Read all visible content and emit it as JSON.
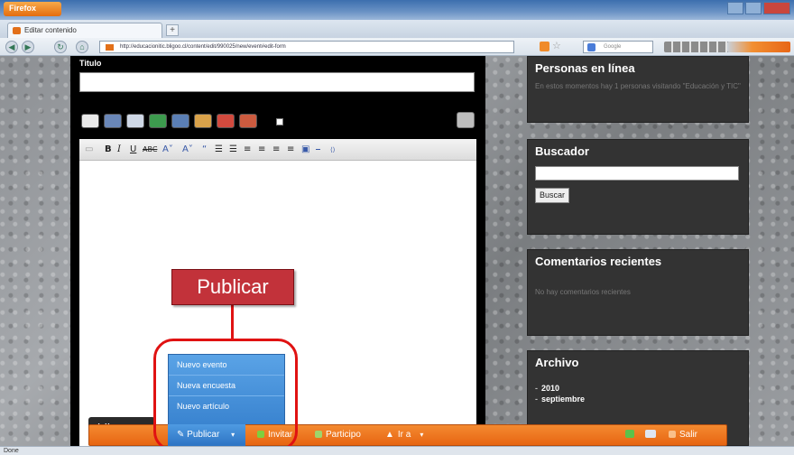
{
  "browser": {
    "app_button": "Firefox",
    "tab_title": "Editar contenido",
    "url": "http://educacionitic.bligoo.cl/content/edit/990025/new/event#edit-form",
    "search_placeholder": "Google",
    "status": "Done"
  },
  "editor": {
    "title_label": "Titulo",
    "title_value": ""
  },
  "sidebar": {
    "online": {
      "heading": "Personas en línea",
      "text": "En estos momentos hay 1 personas visitando \"Educación y TIC\""
    },
    "search": {
      "heading": "Buscador",
      "button": "Buscar"
    },
    "comments": {
      "heading": "Comentarios recientes",
      "text": "No hay comentarios recientes"
    },
    "archive": {
      "heading": "Archivo",
      "items": [
        "2010",
        "septiembre"
      ]
    }
  },
  "bottom_bar": {
    "logo": "bligoo",
    "publicar": "Publicar",
    "invitar": "Invitar",
    "participo": "Participo",
    "ir_a": "Ir a",
    "salir": "Salir"
  },
  "publish_menu": {
    "items": [
      "Nuevo evento",
      "Nueva encuesta",
      "Nuevo artículo"
    ]
  },
  "callout": {
    "label": "Publicar"
  },
  "colors": {
    "toolbar_orange": "#e76512",
    "menu_blue": "#3a84d0",
    "highlight_red": "#e01212",
    "callout_red": "#c2323a"
  }
}
